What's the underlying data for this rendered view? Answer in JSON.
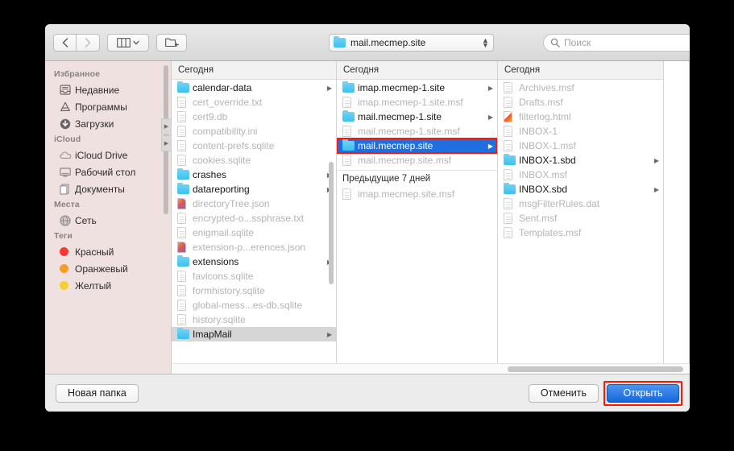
{
  "toolbar": {
    "back_icon": "chevron-left-icon",
    "forward_icon": "chevron-right-icon",
    "view_icon": "column-view-icon",
    "view_chevron": "chevron-down-icon",
    "new_folder_icon": "new-folder-icon",
    "path_value": "mail.mecmep.site",
    "path_icon": "folder-icon",
    "search_icon": "search-icon",
    "search_placeholder": "Поиск"
  },
  "sidebar": {
    "sections": [
      {
        "title": "Избранное",
        "items": [
          {
            "label": "Недавние",
            "icon": "recents-icon"
          },
          {
            "label": "Программы",
            "icon": "applications-icon"
          },
          {
            "label": "Загрузки",
            "icon": "downloads-icon"
          }
        ]
      },
      {
        "title": "iCloud",
        "items": [
          {
            "label": "iCloud Drive",
            "icon": "cloud-icon"
          },
          {
            "label": "Рабочий стол",
            "icon": "desktop-icon"
          },
          {
            "label": "Документы",
            "icon": "documents-icon"
          }
        ]
      },
      {
        "title": "Места",
        "items": [
          {
            "label": "Сеть",
            "icon": "network-icon"
          }
        ]
      },
      {
        "title": "Теги",
        "items": [
          {
            "label": "Красный",
            "icon": "tag-dot-icon",
            "color": "#f63a35"
          },
          {
            "label": "Оранжевый",
            "icon": "tag-dot-icon",
            "color": "#f79a28"
          },
          {
            "label": "Желтый",
            "icon": "tag-dot-icon",
            "color": "#f5d033"
          }
        ]
      }
    ]
  },
  "columns": [
    {
      "header": "Сегодня",
      "rows": [
        {
          "name": "calendar-data",
          "type": "folder",
          "state": "normal",
          "arrow": true
        },
        {
          "name": "cert_override.txt",
          "type": "doc",
          "state": "dim"
        },
        {
          "name": "cert9.db",
          "type": "doc",
          "state": "dim"
        },
        {
          "name": "compatibility.ini",
          "type": "doc",
          "state": "dim"
        },
        {
          "name": "content-prefs.sqlite",
          "type": "doc",
          "state": "dim"
        },
        {
          "name": "cookies.sqlite",
          "type": "doc",
          "state": "dim"
        },
        {
          "name": "crashes",
          "type": "folder",
          "state": "normal",
          "arrow": true
        },
        {
          "name": "datareporting",
          "type": "folder",
          "state": "normal",
          "arrow": true
        },
        {
          "name": "directoryTree.json",
          "type": "json",
          "state": "dim"
        },
        {
          "name": "encrypted-o...ssphrase.txt",
          "type": "doc",
          "state": "dim"
        },
        {
          "name": "enigmail.sqlite",
          "type": "doc",
          "state": "dim"
        },
        {
          "name": "extension-p...erences.json",
          "type": "json",
          "state": "dim"
        },
        {
          "name": "extensions",
          "type": "folder",
          "state": "normal",
          "arrow": true
        },
        {
          "name": "favicons.sqlite",
          "type": "doc",
          "state": "dim"
        },
        {
          "name": "formhistory.sqlite",
          "type": "doc",
          "state": "dim"
        },
        {
          "name": "global-mess...es-db.sqlite",
          "type": "doc",
          "state": "dim"
        },
        {
          "name": "history.sqlite",
          "type": "doc",
          "state": "dim"
        },
        {
          "name": "ImapMail",
          "type": "folder",
          "state": "selected-inactive",
          "arrow": true
        }
      ]
    },
    {
      "header": "Сегодня",
      "rows": [
        {
          "name": "imap.mecmep-1.site",
          "type": "folder",
          "state": "normal",
          "arrow": true
        },
        {
          "name": "imap.mecmep-1.site.msf",
          "type": "doc",
          "state": "dim"
        },
        {
          "name": "mail.mecmep-1.site",
          "type": "folder",
          "state": "normal",
          "arrow": true
        },
        {
          "name": "mail.mecmep-1.site.msf",
          "type": "doc",
          "state": "dim"
        },
        {
          "name": "mail.mecmep.site",
          "type": "folder",
          "state": "selected",
          "arrow": true,
          "annotated": true
        },
        {
          "name": "mail.mecmep.site.msf",
          "type": "doc",
          "state": "dim"
        }
      ],
      "group_header": "Предыдущие 7 дней",
      "group_rows": [
        {
          "name": "imap.mecmep.site.msf",
          "type": "doc",
          "state": "dim"
        }
      ]
    },
    {
      "header": "Сегодня",
      "rows": [
        {
          "name": "Archives.msf",
          "type": "doc",
          "state": "dim"
        },
        {
          "name": "Drafts.msf",
          "type": "doc",
          "state": "dim"
        },
        {
          "name": "filterlog.html",
          "type": "html",
          "state": "dim"
        },
        {
          "name": "INBOX-1",
          "type": "doc",
          "state": "dim"
        },
        {
          "name": "INBOX-1.msf",
          "type": "doc",
          "state": "dim"
        },
        {
          "name": "INBOX-1.sbd",
          "type": "folder",
          "state": "normal",
          "arrow": true
        },
        {
          "name": "INBOX.msf",
          "type": "doc",
          "state": "dim"
        },
        {
          "name": "INBOX.sbd",
          "type": "folder",
          "state": "normal",
          "arrow": true
        },
        {
          "name": "msgFilterRules.dat",
          "type": "doc",
          "state": "dim"
        },
        {
          "name": "Sent.msf",
          "type": "doc",
          "state": "dim"
        },
        {
          "name": "Templates.msf",
          "type": "doc",
          "state": "dim"
        }
      ]
    }
  ],
  "footer": {
    "new_folder_label": "Новая папка",
    "cancel_label": "Отменить",
    "open_label": "Открыть",
    "open_annotated": true
  },
  "colors": {
    "selection_blue": "#1f6fe0",
    "annotation_red": "#ff1500",
    "folder_blue": "#3cc0ef",
    "sidebar_bg": "#eee1e0"
  }
}
